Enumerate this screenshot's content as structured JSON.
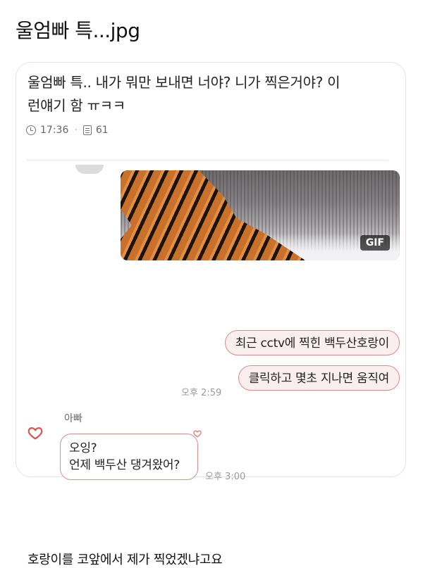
{
  "title": "울엄빠 특...jpg",
  "post": {
    "line1": "울엄빠 특.. 내가 뭐만 보내면 너야? 니가 찍은거야? 이",
    "line2": "런얘기 함 ㅠㅋㅋ",
    "time": "17:36",
    "count": "61"
  },
  "chat": {
    "gif_badge": "GIF",
    "messages_sent": [
      "최근 cctv에 찍힌 백두산호랑이",
      "클릭하고 몇초 지나면 움직여"
    ],
    "sent_time": "오후 2:59",
    "sender_name": "아빠",
    "reply_line1": "오잉?",
    "reply_line2": "언제 백두산 댕겨왔어?",
    "reply_time": "오후 3:00"
  },
  "footer": "호랑이를 코앞에서 제가 찍었겠냐고요",
  "colors": {
    "bubble_border": "#d98c8c",
    "bubble_fill": "#fbeeee",
    "heart": "#d9534f"
  },
  "icons": [
    "clock-icon",
    "document-icon",
    "heart-icon"
  ]
}
